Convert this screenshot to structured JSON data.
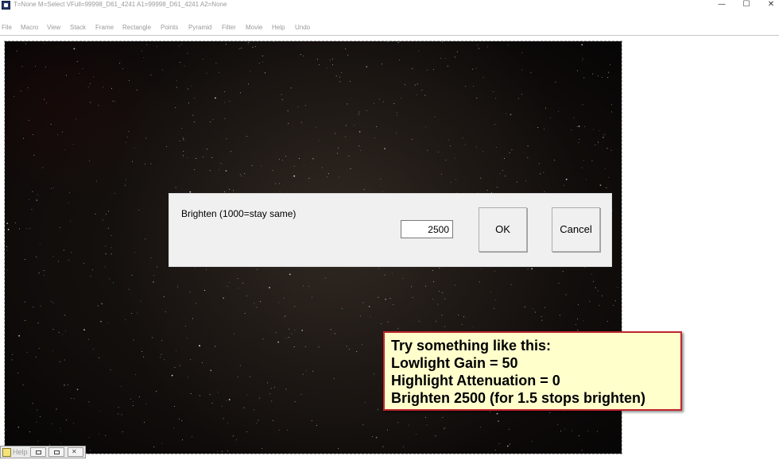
{
  "window": {
    "title": "T=None M=Select VFull=99998_D61_4241 A1=99998_D61_4241 A2=None",
    "minimize_glyph": "—",
    "maximize_glyph": "☐",
    "close_glyph": "✕"
  },
  "menu": {
    "items": [
      "File",
      "Macro",
      "View",
      "Stack",
      "Frame",
      "Rectangle",
      "Points",
      "Pyramid",
      "Filter",
      "Movie",
      "Help",
      "Undo"
    ]
  },
  "dialog": {
    "label": "Brighten (1000=stay same)",
    "value": "2500",
    "ok_label": "OK",
    "cancel_label": "Cancel"
  },
  "note": {
    "lines": [
      "Try something like this:",
      "Lowlight Gain = 50",
      "Highlight Attenuation = 0",
      "Brighten 2500 (for 1.5 stops brighten)"
    ]
  },
  "help_window": {
    "label": "Help"
  },
  "colors": {
    "note_border": "#c0272d",
    "note_background": "#ffffcc",
    "dialog_background": "#f0f0f0"
  },
  "icons": {
    "app": "app-icon",
    "help": "help-book-icon"
  }
}
